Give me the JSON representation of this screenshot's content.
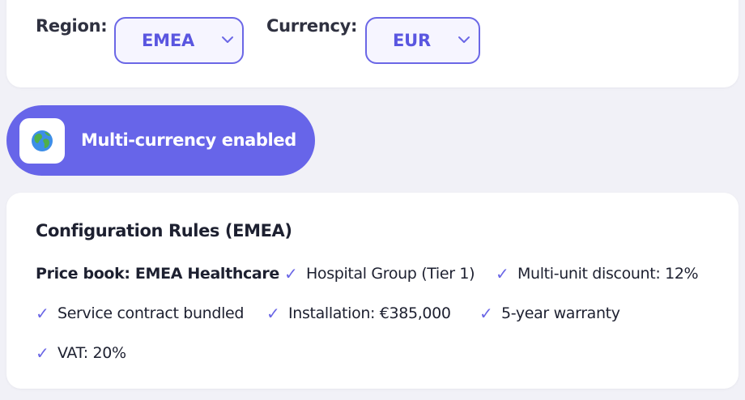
{
  "filters": {
    "region_label": "Region:",
    "region_value": "EMEA",
    "currency_label": "Currency:",
    "currency_value": "EUR"
  },
  "multi_currency": {
    "icon": "globe-icon",
    "label": "Multi-currency enabled"
  },
  "rules": {
    "title": "Configuration Rules (EMEA)",
    "price_book": "Price book: EMEA Healthcare",
    "items": [
      "Hospital Group (Tier 1)",
      "Multi-unit discount: 12%",
      "Service contract bundled",
      "Installation: €385,000",
      "5-year warranty",
      "VAT: 20%"
    ]
  },
  "colors": {
    "accent": "#6765e9",
    "select_border": "#6b67e6",
    "background": "#f1f1f7"
  }
}
